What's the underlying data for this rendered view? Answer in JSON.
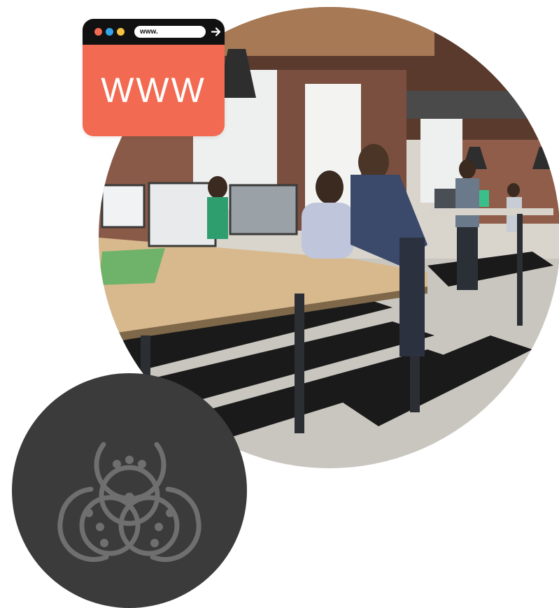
{
  "browser": {
    "url_text": "www.",
    "big_text": "WWW",
    "dots": [
      "#f26a51",
      "#35a4e8",
      "#f5c242"
    ],
    "accent": "#f26a51",
    "bar_color": "#111111",
    "icons": {
      "go": "arrow-right-icon"
    }
  },
  "photo": {
    "subject": "office-photo"
  },
  "badge": {
    "icon": "biohazard-icon",
    "background": "#3b3b3b"
  }
}
